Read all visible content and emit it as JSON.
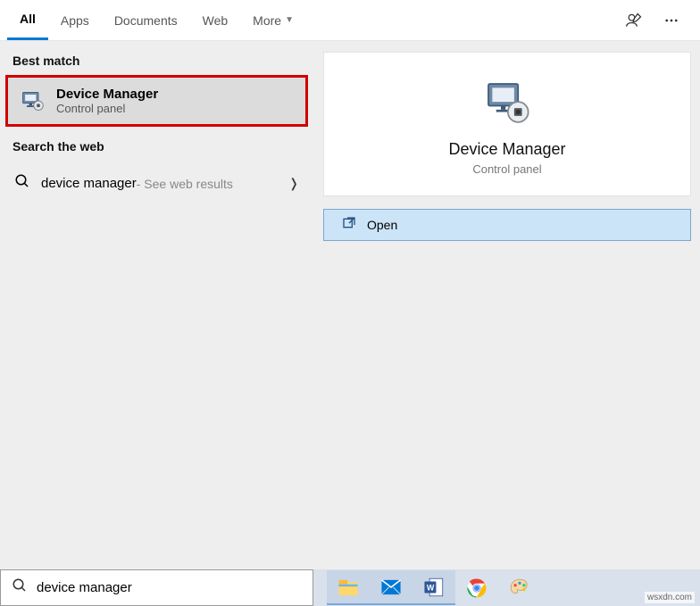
{
  "tabs": {
    "all": "All",
    "apps": "Apps",
    "documents": "Documents",
    "web": "Web",
    "more": "More"
  },
  "sections": {
    "best_match": "Best match",
    "search_web": "Search the web"
  },
  "result": {
    "title": "Device Manager",
    "subtitle": "Control panel"
  },
  "web_result": {
    "query": "device manager",
    "suffix": " - See web results"
  },
  "preview": {
    "title": "Device Manager",
    "subtitle": "Control panel",
    "open": "Open"
  },
  "search": {
    "value": "device manager"
  },
  "watermark": "wsxdn.com"
}
